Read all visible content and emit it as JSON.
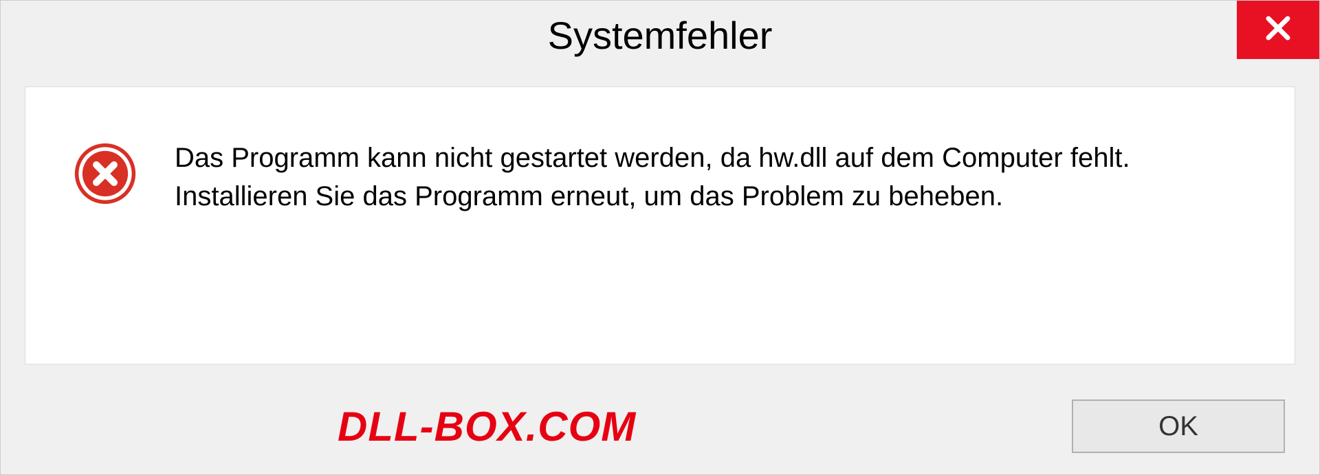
{
  "dialog": {
    "title": "Systemfehler",
    "message_line1": "Das Programm kann nicht gestartet werden, da hw.dll auf dem Computer fehlt.",
    "message_line2": "Installieren Sie das Programm erneut, um das Problem zu beheben.",
    "ok_label": "OK"
  },
  "watermark": "DLL-BOX.COM"
}
